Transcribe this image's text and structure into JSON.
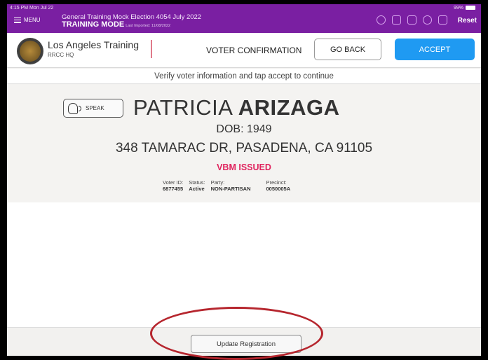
{
  "status_bar": {
    "time": "4:15 PM  Mon Jul 22",
    "battery": "99%"
  },
  "topbar": {
    "menu_label": "MENU",
    "election": "General Training Mock Election 4054  July 2022",
    "mode": "TRAINING MODE",
    "last_imported": "Last Imported: 11/08/2022",
    "icons": [
      "history-icon",
      "mail-icon",
      "printer-icon",
      "cloud-sync-icon",
      "users-icon"
    ],
    "reset_label": "Reset"
  },
  "header": {
    "org_name": "Los Angeles Training",
    "org_sub": "RRCC HQ",
    "title": "VOTER CONFIRMATION",
    "go_back_label": "GO BACK",
    "accept_label": "ACCEPT",
    "accent_color": "#1f9af2"
  },
  "instruction": "Verify voter information and tap accept to continue",
  "voter": {
    "speak_label": "SPEAK",
    "first_name": "PATRICIA",
    "last_name": "ARIZAGA",
    "dob": "DOB: 1949",
    "address": "348 TAMARAC DR, PASADENA, CA 91105",
    "status_flag": "VBM ISSUED",
    "details": [
      {
        "label": "Voter ID:",
        "value": "6877455"
      },
      {
        "label": "Status:",
        "value": "Active"
      },
      {
        "label": "Party:",
        "value": "NON-PARTISAN"
      },
      {
        "label": "Precinct:",
        "value": "0050005A"
      }
    ]
  },
  "footer": {
    "update_label": "Update Registration"
  },
  "colors": {
    "topbar": "#7a1fa2",
    "alert": "#e0245e",
    "annotation": "#b6262e"
  }
}
